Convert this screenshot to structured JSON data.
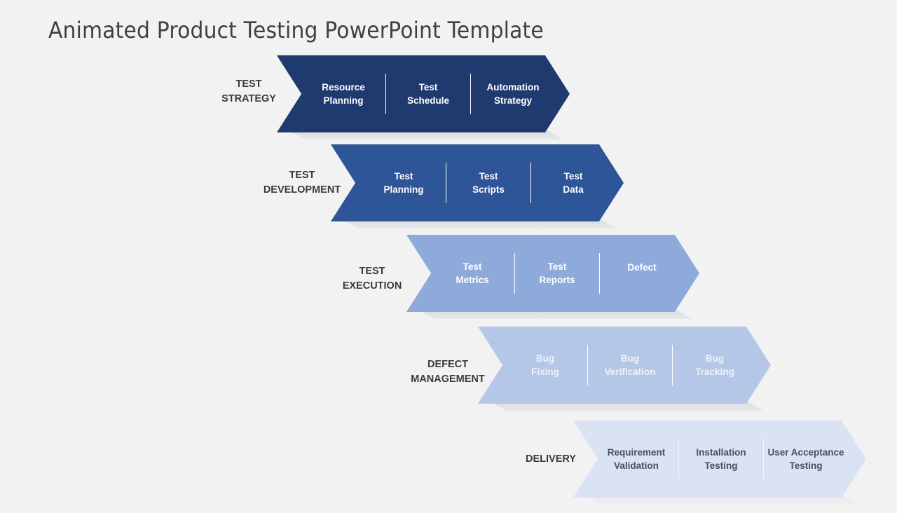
{
  "title": "Animated Product Testing PowerPoint Template",
  "colors": {
    "stage_1": "#1f3a6e",
    "stage_2": "#2e5597",
    "stage_3": "#8eaadb",
    "stage_4": "#b4c7e7",
    "stage_5": "#dae3f3",
    "label_text": "#3a3a3a"
  },
  "stages": [
    {
      "label": "TEST\nSTRATEGY",
      "items": [
        "Resource\nPlanning",
        "Test\nSchedule",
        "Automation\nStrategy"
      ]
    },
    {
      "label": "TEST\nDEVELOPMENT",
      "items": [
        "Test\nPlanning",
        "Test\nScripts",
        "Test\nData"
      ]
    },
    {
      "label": "TEST\nEXECUTION",
      "items": [
        "Test\nMetrics",
        "Test\nReports",
        "Defect"
      ]
    },
    {
      "label": "DEFECT\nMANAGEMENT",
      "items": [
        "Bug\nFixing",
        "Bug\nVerification",
        "Bug\nTracking"
      ]
    },
    {
      "label": "DELIVERY",
      "items": [
        "Requirement\nValidation",
        "Installation\nTesting",
        "User Acceptance\nTesting"
      ]
    }
  ]
}
